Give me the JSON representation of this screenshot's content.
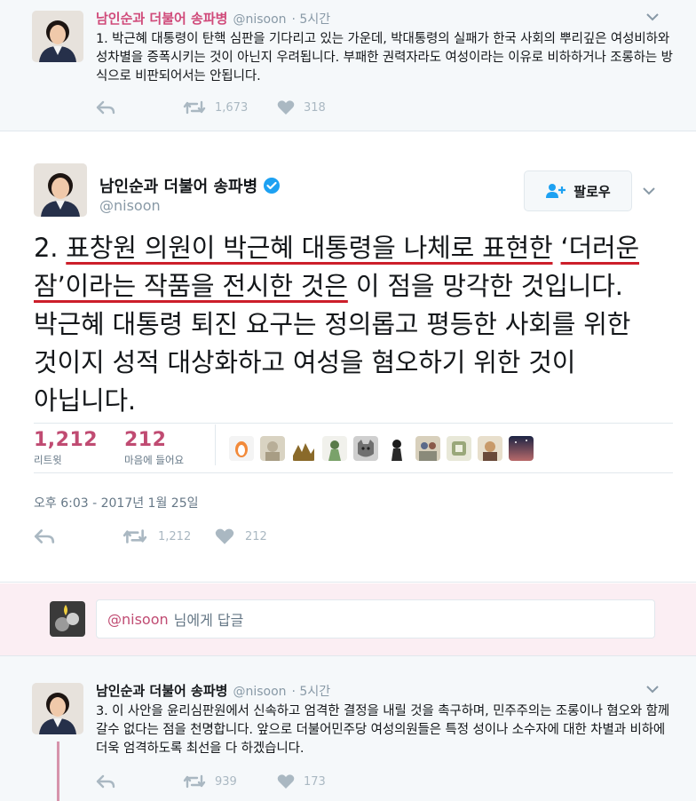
{
  "tweet1": {
    "name": "남인순과 더불어 송파병",
    "handle": "@nisoon",
    "time": "· 5시간",
    "text": "1. 박근혜 대통령이 탄핵 심판을 기다리고 있는 가운데, 박대통령의 실패가 한국 사회의 뿌리깊은 여성비하와 성차별을 증폭시키는 것이 아닌지 우려됩니다. 부패한 권력자라도 여성이라는 이유로 비하하거나 조롱하는 방식으로 비판되어서는 안됩니다.",
    "retweets": "1,673",
    "likes": "318"
  },
  "tweet2": {
    "name": "남인순과 더불어 송파병",
    "handle": "@nisoon",
    "follow_label": "팔로우",
    "text_prefix": "2. ",
    "text_underlined_1": "표창원 의원이 박근혜 대통령을 나체로 표현한",
    "text_mid": " ",
    "text_underlined_2": "‘더러운 잠’이라는 작품을 전시한 것은",
    "text_rest": " 이 점을 망각한 것입니다. 박근혜 대통령 퇴진 요구는 정의롭고 평등한 사회를 위한 것이지 성적 대상화하고 여성을 혐오하기 위한 것이 아닙니다.",
    "retweet_count": "1,212",
    "retweet_label": "리트윗",
    "like_count": "212",
    "like_label": "마음에 들어요",
    "timestamp": "오후 6:03 - 2017년 1월 25일",
    "action_retweets": "1,212",
    "action_likes": "212"
  },
  "reply": {
    "mention": "@nisoon",
    "placeholder_rest": "님에게 답글"
  },
  "tweet3": {
    "name": "남인순과 더불어 송파병",
    "handle": "@nisoon",
    "time": "· 5시간",
    "text": "3. 이 사안을 윤리심판원에서 신속하고 엄격한 결정을 내릴 것을 촉구하며, 민주주의는 조롱이나 혐오와 함께 갈수 없다는 점을 천명합니다. 앞으로 더불어민주당 여성의원들은 특정 성이나 소수자에 대한 차별과 비하에 더욱 엄격하도록 최선을 다 하겠습니다.",
    "retweets": "939",
    "likes": "173"
  },
  "colors": {
    "accent": "#c04b72",
    "underline": "#cc1e2a",
    "verified": "#1da1f2",
    "muted": "#aab8c2"
  }
}
